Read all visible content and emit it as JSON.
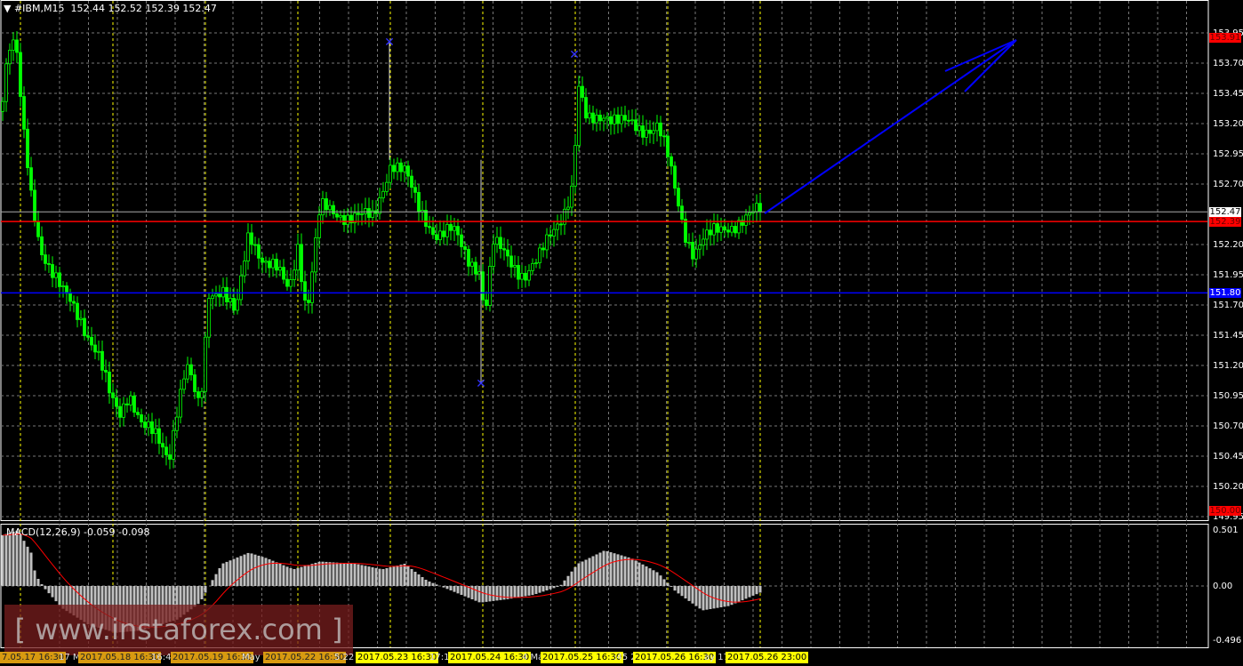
{
  "header": {
    "symbol": "#IBM,M15",
    "ohlc": "152.44 152.52 152.39 152.47"
  },
  "indicator": {
    "label": "MACD(12,26,9) -0.059 -0.098",
    "scale": [
      "0.501",
      "0.00",
      "-0.496"
    ]
  },
  "price_scale": [
    "153.95",
    "153.70",
    "153.45",
    "153.20",
    "152.95",
    "152.70",
    "152.20",
    "151.95",
    "151.70",
    "151.45",
    "151.20",
    "150.95",
    "150.70",
    "150.45",
    "150.20",
    "149.95"
  ],
  "price_tags": {
    "high": {
      "text": "153.91",
      "color": "#ff0000"
    },
    "current": {
      "text": "152.47",
      "color": "#ffffff"
    },
    "red_line": {
      "text": "152.39",
      "color": "#ff0000"
    },
    "blue_line": {
      "text": "151.80",
      "color": "#0000ff"
    },
    "low": {
      "text": "150.00",
      "color": "#ff0000"
    }
  },
  "watermark": "[ www.instaforex.com ]",
  "time_axis": [
    {
      "t": "7.05.17 16:30",
      "s": "o"
    },
    {
      "t": "17 M",
      "s": ""
    },
    {
      "t": "2017.05.18 16:30",
      "s": "o"
    },
    {
      "t": "16:45",
      "s": ""
    },
    {
      "t": "2017.05.19 16:30",
      "s": "o"
    },
    {
      "t": "May",
      "s": ""
    },
    {
      "t": "2017.05.22 16:30",
      "s": "o"
    },
    {
      "t": "5  22",
      "s": ""
    },
    {
      "t": "2017.05.23 16:30",
      "s": "y"
    },
    {
      "t": "17:1",
      "s": ""
    },
    {
      "t": "2017.05.24 16:30",
      "s": "y"
    },
    {
      "t": "4 May",
      "s": ""
    },
    {
      "t": "2017.05.25 16:30",
      "s": "y"
    },
    {
      "t": ":45  2",
      "s": ""
    },
    {
      "t": "2017.05.26 16:30",
      "s": "y"
    },
    {
      "t": "ay 17",
      "s": ""
    },
    {
      "t": "2017.05.26 23:00",
      "s": "y"
    }
  ],
  "colors": {
    "bull": "#00ff00",
    "bear": "#00ff00",
    "macd_hist": "#c0c0c0",
    "signal": "#ff0000",
    "arrow": "#0000ff"
  },
  "chart_data": {
    "type": "candlestick",
    "price_path": [
      [
        0,
        153.3
      ],
      [
        10,
        153.85
      ],
      [
        18,
        153.85
      ],
      [
        25,
        153.2
      ],
      [
        35,
        152.6
      ],
      [
        45,
        152.2
      ],
      [
        70,
        151.8
      ],
      [
        90,
        151.6
      ],
      [
        110,
        151.3
      ],
      [
        125,
        150.9
      ],
      [
        135,
        150.8
      ],
      [
        145,
        151.0
      ],
      [
        160,
        150.7
      ],
      [
        175,
        150.6
      ],
      [
        190,
        150.45
      ],
      [
        200,
        150.9
      ],
      [
        210,
        151.2
      ],
      [
        225,
        150.8
      ],
      [
        235,
        151.8
      ],
      [
        250,
        151.85
      ],
      [
        265,
        151.6
      ],
      [
        280,
        152.3
      ],
      [
        295,
        152.1
      ],
      [
        310,
        152.0
      ],
      [
        325,
        151.8
      ],
      [
        335,
        152.2
      ],
      [
        345,
        151.65
      ],
      [
        360,
        152.5
      ],
      [
        375,
        152.45
      ],
      [
        400,
        152.45
      ],
      [
        420,
        152.4
      ],
      [
        440,
        152.9
      ],
      [
        455,
        152.8
      ],
      [
        470,
        152.5
      ],
      [
        490,
        152.3
      ],
      [
        510,
        152.3
      ],
      [
        525,
        152.1
      ],
      [
        540,
        152.0
      ],
      [
        545,
        151.6
      ],
      [
        555,
        152.2
      ],
      [
        570,
        152.1
      ],
      [
        590,
        151.95
      ],
      [
        605,
        152.05
      ],
      [
        620,
        152.3
      ],
      [
        635,
        152.5
      ],
      [
        645,
        152.7
      ],
      [
        650,
        153.5
      ],
      [
        660,
        153.2
      ],
      [
        680,
        153.3
      ],
      [
        700,
        153.2
      ],
      [
        720,
        153.15
      ],
      [
        740,
        153.2
      ],
      [
        750,
        152.95
      ],
      [
        760,
        152.6
      ],
      [
        770,
        152.3
      ],
      [
        780,
        152.15
      ],
      [
        790,
        152.25
      ],
      [
        810,
        152.3
      ],
      [
        830,
        152.4
      ],
      [
        855,
        152.47
      ]
    ],
    "macd_path": [
      [
        0,
        0.45
      ],
      [
        20,
        0.5
      ],
      [
        35,
        0.3
      ],
      [
        40,
        0.1
      ],
      [
        50,
        -0.02
      ],
      [
        70,
        -0.2
      ],
      [
        100,
        -0.35
      ],
      [
        130,
        -0.42
      ],
      [
        160,
        -0.4
      ],
      [
        200,
        -0.3
      ],
      [
        225,
        -0.15
      ],
      [
        235,
        0.0
      ],
      [
        250,
        0.2
      ],
      [
        280,
        0.3
      ],
      [
        300,
        0.25
      ],
      [
        330,
        0.15
      ],
      [
        360,
        0.22
      ],
      [
        400,
        0.2
      ],
      [
        430,
        0.15
      ],
      [
        455,
        0.2
      ],
      [
        480,
        0.05
      ],
      [
        510,
        -0.05
      ],
      [
        540,
        -0.15
      ],
      [
        570,
        -0.12
      ],
      [
        600,
        -0.08
      ],
      [
        630,
        0.0
      ],
      [
        650,
        0.2
      ],
      [
        680,
        0.32
      ],
      [
        710,
        0.25
      ],
      [
        740,
        0.12
      ],
      [
        760,
        -0.05
      ],
      [
        790,
        -0.22
      ],
      [
        820,
        -0.18
      ],
      [
        855,
        -0.06
      ]
    ],
    "levels": [
      152.39,
      151.8
    ],
    "ylim": [
      149.95,
      153.95
    ]
  }
}
